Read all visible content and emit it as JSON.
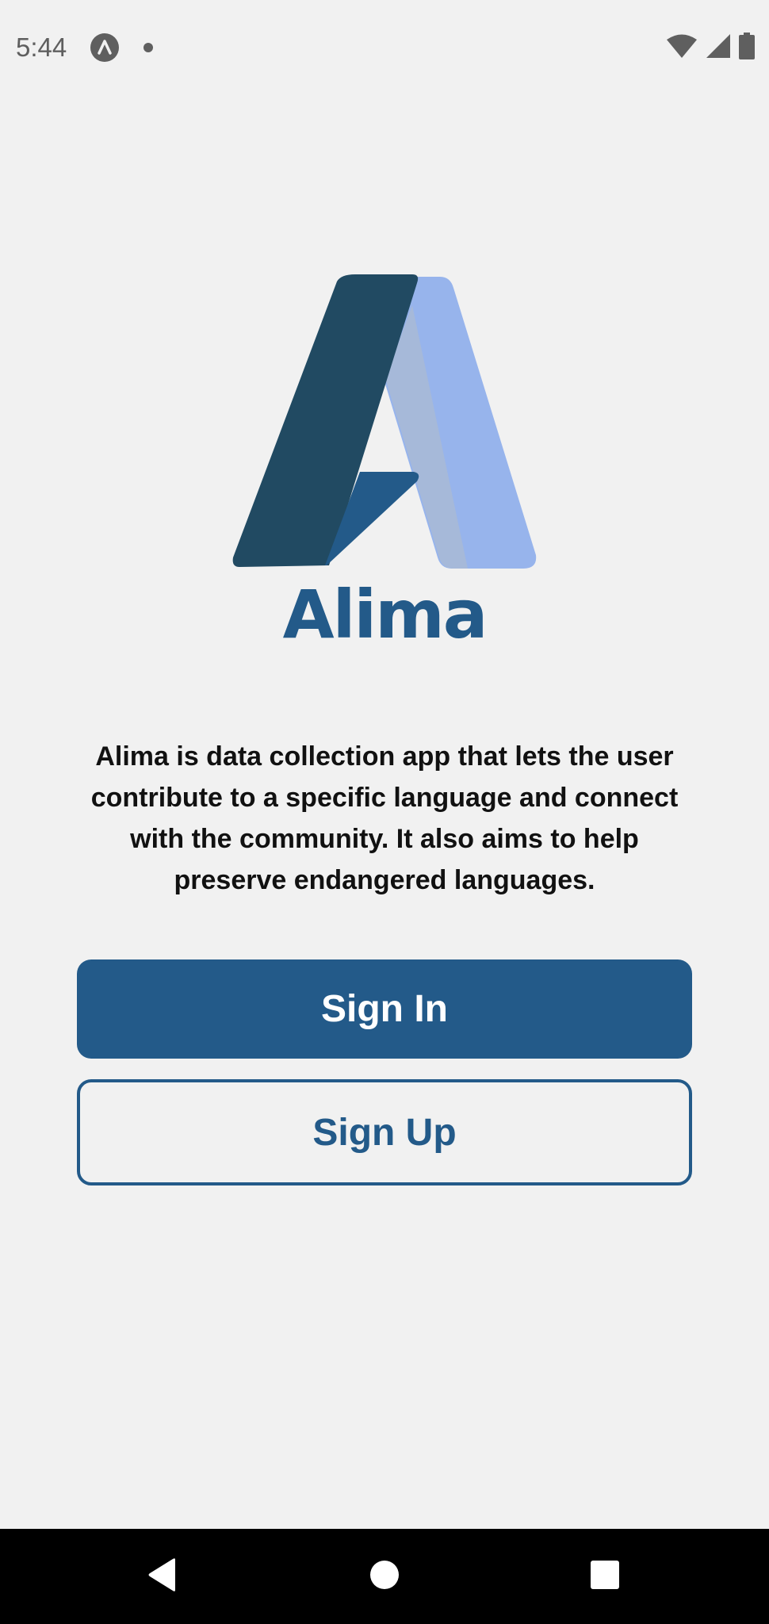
{
  "status_bar": {
    "time": "5:44"
  },
  "brand": {
    "name": "Alima",
    "color_primary": "#235a89",
    "color_dark": "#214a62",
    "color_light": "#97b4ec",
    "color_mid": "#a6b9d9"
  },
  "intro": {
    "description": "Alima is data collection app that lets the user contribute to a specific language and connect with the community. It also aims to help preserve endangered languages."
  },
  "actions": {
    "sign_in_label": "Sign In",
    "sign_up_label": "Sign Up"
  },
  "icons": {
    "app_badge": "app-badge-icon",
    "notification": "notification-dot-icon",
    "wifi": "wifi-icon",
    "signal": "signal-icon",
    "battery": "battery-icon",
    "back": "back-icon",
    "home": "home-icon",
    "recents": "recents-icon"
  }
}
